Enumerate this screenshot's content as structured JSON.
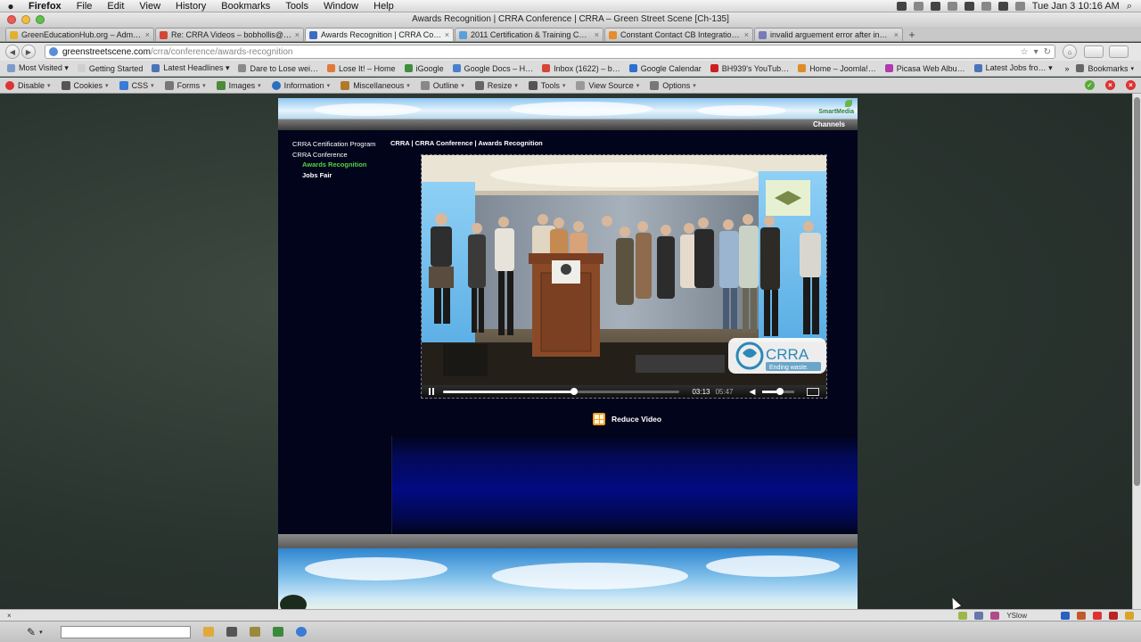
{
  "menubar": {
    "app": "Firefox",
    "items": [
      "File",
      "Edit",
      "View",
      "History",
      "Bookmarks",
      "Tools",
      "Window",
      "Help"
    ],
    "clock": "Tue Jan 3  10:16 AM"
  },
  "window": {
    "title": "Awards Recognition | CRRA Conference | CRRA – Green Street Scene [Ch-135]"
  },
  "tabs": [
    {
      "label": "GreenEducationHub.org – Admi…",
      "color": "#e0b12e"
    },
    {
      "label": "Re: CRRA Videos – bobhollis@g…",
      "color": "#d44638"
    },
    {
      "label": "Awards Recognition | CRRA Con…",
      "color": "#3b6bc4"
    },
    {
      "label": "2011 Certification & Training C…",
      "color": "#5aa0d8"
    },
    {
      "label": "Constant Contact CB Integratio…",
      "color": "#e88b2a"
    },
    {
      "label": "invalid arguement error after in…",
      "color": "#7a7ab8"
    }
  ],
  "url": {
    "domain": "greenstreetscene.com",
    "path": "/crra/conference/awards-recognition"
  },
  "bookmarks": [
    {
      "label": "Most Visited ▾",
      "color": "#7d9bc7"
    },
    {
      "label": "Getting Started",
      "color": "#cfcfcf"
    },
    {
      "label": "Latest Headlines ▾",
      "color": "#4b74b8"
    },
    {
      "label": "Dare to Lose wei…",
      "color": "#8a8a8a"
    },
    {
      "label": "Lose It! – Home",
      "color": "#e0793a"
    },
    {
      "label": "iGoogle",
      "color": "#3e8e3e"
    },
    {
      "label": "Google Docs – H…",
      "color": "#4a7fd0"
    },
    {
      "label": "Inbox (1622) – b…",
      "color": "#d44638"
    },
    {
      "label": "Google Calendar",
      "color": "#2f6fd0"
    },
    {
      "label": "BH939's YouTub…",
      "color": "#cc2020"
    },
    {
      "label": "Home – Joomla!…",
      "color": "#e08a2a"
    },
    {
      "label": "Picasa Web Albu…",
      "color": "#b03ab0"
    },
    {
      "label": "Latest Jobs fro… ▾",
      "color": "#4b74b8"
    }
  ],
  "bookmarks_right": "Bookmarks",
  "devbar": [
    {
      "label": "Disable",
      "color": "#d33"
    },
    {
      "label": "Cookies",
      "color": "#555"
    },
    {
      "label": "CSS",
      "color": "#3a7bd5"
    },
    {
      "label": "Forms",
      "color": "#777"
    },
    {
      "label": "Images",
      "color": "#4d8a3a"
    },
    {
      "label": "Information",
      "color": "#2b6fc0"
    },
    {
      "label": "Miscellaneous",
      "color": "#b07a2a"
    },
    {
      "label": "Outline",
      "color": "#888"
    },
    {
      "label": "Resize",
      "color": "#666"
    },
    {
      "label": "Tools",
      "color": "#555"
    },
    {
      "label": "View Source",
      "color": "#999"
    },
    {
      "label": "Options",
      "color": "#777"
    }
  ],
  "site": {
    "logo": "SmartMedia",
    "channels": "Channels",
    "nav": {
      "cert": "CRRA Certification Program",
      "conference": "CRRA Conference",
      "awards": "Awards Recognition",
      "jobs": "Jobs Fair"
    },
    "breadcrumb": "CRRA | CRRA Conference | Awards Recognition",
    "video": {
      "overlay_title": "CRRA",
      "overlay_tagline": "Ending waste.",
      "time_current": "03:13",
      "time_total": "05:47",
      "progress": 0.55,
      "volume": 0.55
    },
    "reduce_label": "Reduce Video"
  },
  "addonbar": {
    "yslow": "YSlow"
  }
}
